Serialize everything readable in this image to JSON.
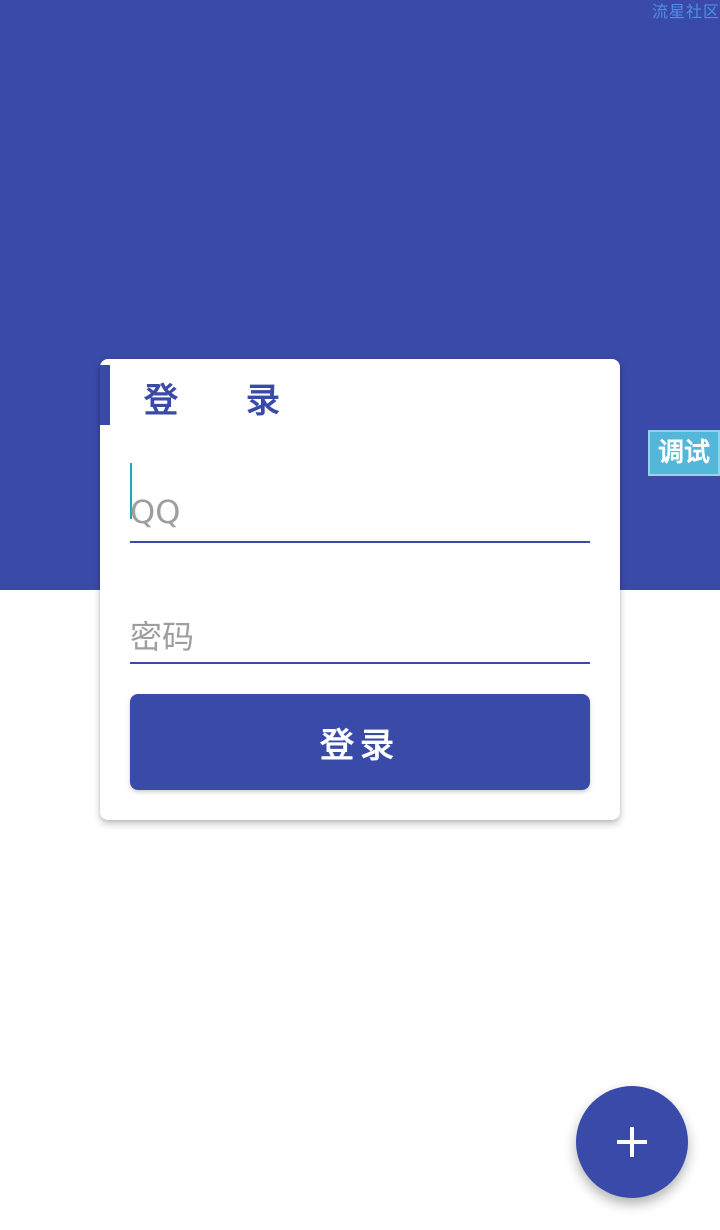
{
  "watermark": "流星社区",
  "login_card": {
    "title": "登 录",
    "qq_field": {
      "placeholder": "QQ",
      "value": ""
    },
    "password_field": {
      "placeholder": "密码",
      "value": ""
    },
    "submit_label": "登录"
  },
  "debug_tag": {
    "label": "调试"
  },
  "fab": {
    "icon": "plus-icon"
  },
  "colors": {
    "primary": "#3a4aa9",
    "debug_tag": "#52b7d9",
    "watermark": "#4f8fe8",
    "caret": "#26a6b0",
    "placeholder": "#9e9e9e"
  }
}
